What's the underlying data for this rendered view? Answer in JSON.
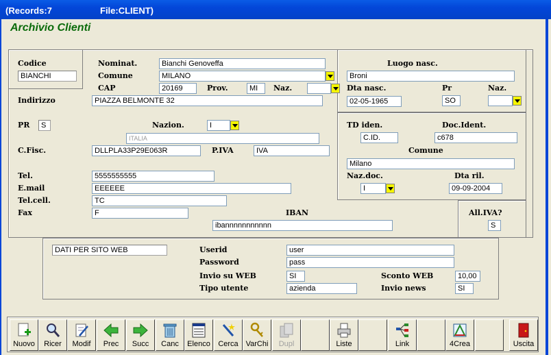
{
  "titlebar": {
    "records": "(Records:7",
    "file": "File:CLIENT)"
  },
  "heading": "Archivio Clienti",
  "labels": {
    "codice": "Codice",
    "nominat": "Nominat.",
    "comune": "Comune",
    "cap": "CAP",
    "prov": "Prov.",
    "naz": "Naz.",
    "luogo_nasc": "Luogo nasc.",
    "dta_nasc": "Dta nasc.",
    "pr": "Pr",
    "naz2": "Naz.",
    "indirizzo": "Indirizzo",
    "pr2": "PR",
    "nazion": "Nazion.",
    "td_iden": "TD iden.",
    "doc_ident": "Doc.Ident.",
    "cfisc": "C.Fisc.",
    "piva": "P.IVA",
    "comune2": "Comune",
    "tel": "Tel.",
    "email": "E.mail",
    "telcell": "Tel.cell.",
    "fax": "Fax",
    "iban": "IBAN",
    "naz_doc": "Naz.doc.",
    "dta_ril": "Dta ril.",
    "all_iva": "All.IVA?",
    "userid": "Userid",
    "password": "Password",
    "invio_web": "Invio su WEB",
    "sconto_web": "Sconto WEB",
    "tipo_utente": "Tipo utente",
    "invio_news": "Invio news"
  },
  "fields": {
    "codice": "BIANCHI",
    "nominat": "Bianchi Genoveffa",
    "comune": "MILANO",
    "cap": "20169",
    "prov": "MI",
    "naz": "",
    "luogo_nasc": "Broni",
    "dta_nasc": "02-05-1965",
    "pr": "SO",
    "naz2": "",
    "indirizzo": "PIAZZA BELMONTE 32",
    "pr2": "S",
    "nazion": "I",
    "nazion_desc": "ITALIA",
    "td_iden": "C.ID.",
    "doc_ident": "c678",
    "cfisc": "DLLPLA33P29E063R",
    "piva": "IVA",
    "comune2": "Milano",
    "tel": "5555555555",
    "email": "EEEEEE",
    "telcell": "TC",
    "fax": "F",
    "iban": "ibannnnnnnnnnn",
    "naz_doc": "I",
    "dta_ril": "09-09-2004",
    "all_iva": "S",
    "sito_web": "DATI PER SITO WEB",
    "userid": "user",
    "password": "pass",
    "invio_web": "SI",
    "sconto_web": "10,00",
    "tipo_utente": "azienda",
    "invio_news": "SI"
  },
  "toolbar": [
    {
      "label": "Nuovo",
      "icon": "new-document-icon"
    },
    {
      "label": "Ricer",
      "icon": "magnifier-icon"
    },
    {
      "label": "Modif",
      "icon": "edit-document-icon"
    },
    {
      "label": "Prec",
      "icon": "arrow-left-icon"
    },
    {
      "label": "Succ",
      "icon": "arrow-right-icon"
    },
    {
      "label": "Canc",
      "icon": "trash-icon"
    },
    {
      "label": "Elenco",
      "icon": "list-icon"
    },
    {
      "label": "Cerca",
      "icon": "wand-icon"
    },
    {
      "label": "VarChi",
      "icon": "keys-icon"
    },
    {
      "label": "Dupl",
      "icon": "duplicate-icon"
    },
    {
      "label": "Liste",
      "icon": "printer-icon"
    },
    {
      "label": "Link",
      "icon": "tree-icon"
    },
    {
      "label": "4Crea",
      "icon": "crea-icon"
    },
    {
      "label": "Uscita",
      "icon": "exit-door-icon"
    }
  ],
  "colors": {
    "heading": "#0b6b0b",
    "titlebar": "#0346d8",
    "dropdown": "#f5f500"
  }
}
